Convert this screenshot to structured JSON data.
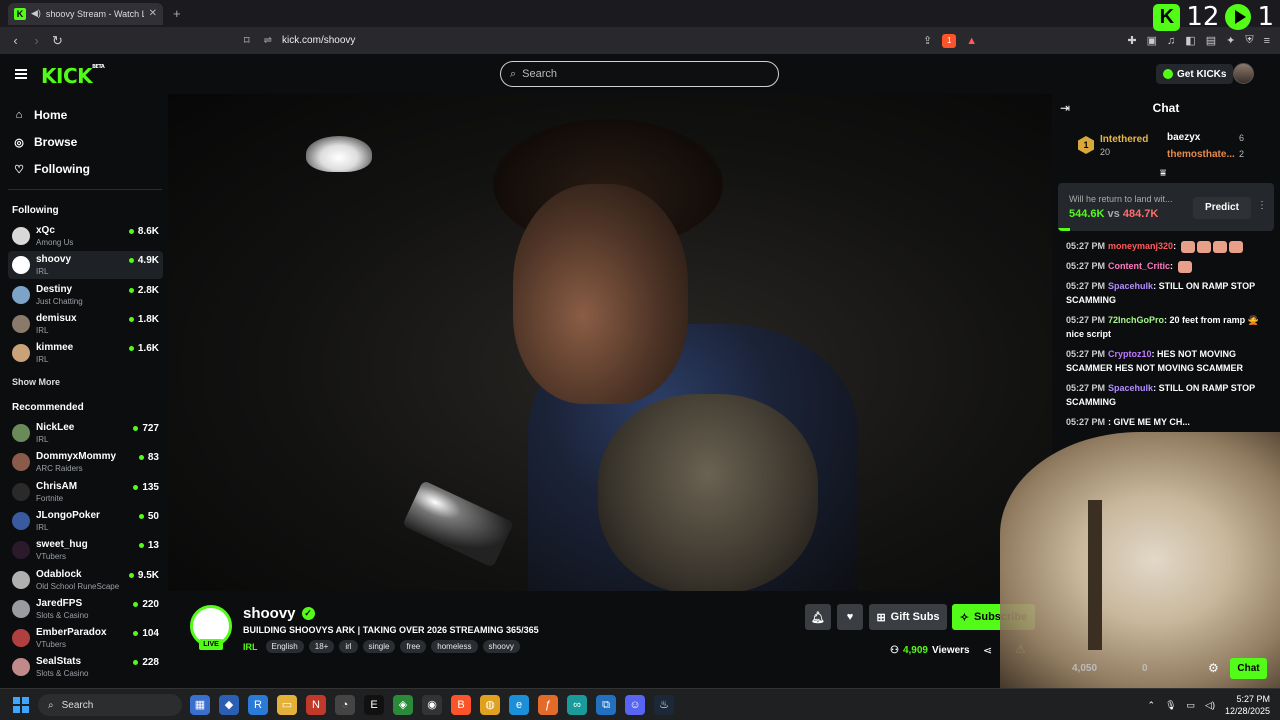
{
  "browser": {
    "tab_title": "shoovy Stream - Watch Live on Kick",
    "new_tab_symbol": "+",
    "url": "kick.com/shoovy",
    "brand_numbers": [
      "12",
      "1"
    ],
    "brave_badge": "1"
  },
  "header": {
    "logo": "KICK",
    "logo_sup": "BETA",
    "search_placeholder": "Search",
    "get_kicks_label": "Get KICKs"
  },
  "sidebar": {
    "nav": [
      {
        "label": "Home",
        "icon": "home-icon",
        "glyph": "⌂"
      },
      {
        "label": "Browse",
        "icon": "compass-icon",
        "glyph": "◎"
      },
      {
        "label": "Following",
        "icon": "heart-icon",
        "glyph": "♡"
      }
    ],
    "following_title": "Following",
    "following": [
      {
        "name": "xQc",
        "category": "Among Us",
        "viewers": "8.6K",
        "color": "#d8d8d8"
      },
      {
        "name": "shoovy",
        "category": "IRL",
        "viewers": "4.9K",
        "color": "#ffffff"
      },
      {
        "name": "Destiny",
        "category": "Just Chatting",
        "viewers": "2.8K",
        "color": "#7ea3c9"
      },
      {
        "name": "demisux",
        "category": "IRL",
        "viewers": "1.8K",
        "color": "#8a7a6a"
      },
      {
        "name": "kimmee",
        "category": "IRL",
        "viewers": "1.6K",
        "color": "#c9a27a"
      }
    ],
    "show_more": "Show More",
    "recommended_title": "Recommended",
    "recommended": [
      {
        "name": "NickLee",
        "category": "IRL",
        "viewers": "727",
        "color": "#6a8a5a"
      },
      {
        "name": "DommyxMommy",
        "category": "ARC Raiders",
        "viewers": "83",
        "color": "#8a5a4a"
      },
      {
        "name": "ChrisAM",
        "category": "Fortnite",
        "viewers": "135",
        "color": "#2a2a2a"
      },
      {
        "name": "JLongoPoker",
        "category": "IRL",
        "viewers": "50",
        "color": "#3a5aa0"
      },
      {
        "name": "sweet_hug",
        "category": "VTubers",
        "viewers": "13",
        "color": "#2a1a2a"
      },
      {
        "name": "Odablock",
        "category": "Old School RuneScape",
        "viewers": "9.5K",
        "color": "#b0b0b0"
      },
      {
        "name": "JaredFPS",
        "category": "Slots & Casino",
        "viewers": "220",
        "color": "#9a9aa0"
      },
      {
        "name": "EmberParadox",
        "category": "VTubers",
        "viewers": "104",
        "color": "#b04040"
      },
      {
        "name": "SealStats",
        "category": "Slots & Casino",
        "viewers": "228",
        "color": "#c08a8a"
      }
    ]
  },
  "stream": {
    "streamer": "shoovy",
    "live_label": "LIVE",
    "title": "BUILDING SHOOVYS ARK | TAKING OVER 2026 STREAMING 365/365",
    "category": "IRL",
    "tags": [
      "English",
      "18+",
      "irl",
      "single",
      "free",
      "homeless",
      "shoovy"
    ],
    "gift_subs_label": "Gift Subs",
    "subscribe_label": "Subscribe",
    "viewers_count": "4,909",
    "viewers_label": "Viewers"
  },
  "chat": {
    "title": "Chat",
    "leaderboard": {
      "rank": "1",
      "first": {
        "name": "Intethered",
        "count": "20"
      },
      "second": {
        "name": "baezyx",
        "count": "6"
      },
      "third": {
        "name": "themosthate...",
        "count": "2"
      }
    },
    "prediction": {
      "question": "Will he return to land wit...",
      "left_amount": "544.6K",
      "vs": "vs",
      "right_amount": "484.7K",
      "predict_label": "Predict"
    },
    "messages": [
      {
        "time": "05:27 PM",
        "user": "moneymanj320",
        "color": "#ff5a5a",
        "text": ""
      },
      {
        "time": "05:27 PM",
        "user": "Content_Critic",
        "color": "#ff7ac0",
        "text": ""
      },
      {
        "time": "05:27 PM",
        "user": "Spacehulk",
        "color": "#b28dff",
        "text": "STILL ON RAMP STOP SCAMMING"
      },
      {
        "time": "05:27 PM",
        "user": "72InchGoPro",
        "color": "#a8f58a",
        "text": "20 feet from ramp 🙅 nice script"
      },
      {
        "time": "05:27 PM",
        "user": "Cryptoz10",
        "color": "#c07aff",
        "text": "HES NOT MOVING SCAMMER HES NOT MOVING SCAMMER"
      },
      {
        "time": "05:27 PM",
        "user": "Spacehulk",
        "color": "#b28dff",
        "text": "STILL ON RAMP STOP SCAMMING"
      },
      {
        "time": "05:27 PM",
        "user": "",
        "color": "#cccccc",
        "text": "GIVE ME MY CH..."
      }
    ],
    "kicks_amount": "4,050",
    "zero_amount": "0",
    "chat_button": "Chat"
  },
  "taskbar": {
    "search_label": "Search",
    "time": "5:27 PM",
    "date": "12/28/2025"
  }
}
